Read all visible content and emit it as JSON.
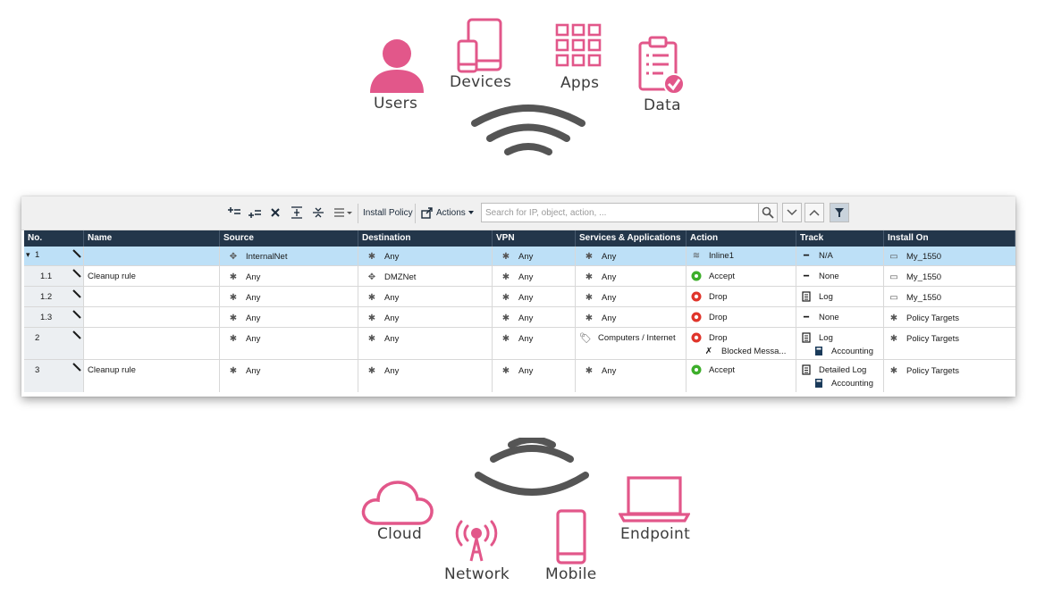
{
  "top_icons": [
    {
      "label": "Users",
      "icon": "user-icon"
    },
    {
      "label": "Devices",
      "icon": "devices-icon"
    },
    {
      "label": "Apps",
      "icon": "apps-grid-icon"
    },
    {
      "label": "Data",
      "icon": "clipboard-check-icon"
    }
  ],
  "bottom_icons": [
    {
      "label": "Cloud",
      "icon": "cloud-icon"
    },
    {
      "label": "Network",
      "icon": "network-antenna-icon"
    },
    {
      "label": "Mobile",
      "icon": "mobile-icon"
    },
    {
      "label": "Endpoint",
      "icon": "laptop-icon"
    }
  ],
  "colors": {
    "accent": "#e2578a",
    "wifi": "#555555",
    "header": "#23364a",
    "selected_row": "#bde0f7",
    "accept": "#3dae2b",
    "drop": "#e0352b"
  },
  "toolbar": {
    "install_policy": "Install Policy",
    "actions": "Actions",
    "search_placeholder": "Search for IP, object, action, ..."
  },
  "columns": [
    "No.",
    "Name",
    "Source",
    "Destination",
    "VPN",
    "Services & Applications",
    "Action",
    "Track",
    "Install On"
  ],
  "rows": [
    {
      "no": "1",
      "expander": "▾",
      "name": "",
      "source": "InternalNet",
      "destination": "Any",
      "vpn": "Any",
      "services": "Any",
      "action": "Inline1",
      "track": "N/A",
      "track2": "",
      "install_on": "My_1550"
    },
    {
      "no": "1.1",
      "name": "Cleanup rule",
      "source": "Any",
      "destination": "DMZNet",
      "vpn": "Any",
      "services": "Any",
      "action": "Accept",
      "track": "None",
      "track2": "",
      "install_on": "My_1550"
    },
    {
      "no": "1.2",
      "name": "",
      "source": "Any",
      "destination": "Any",
      "vpn": "Any",
      "services": "Any",
      "action": "Drop",
      "track": "Log",
      "track2": "",
      "install_on": "My_1550"
    },
    {
      "no": "1.3",
      "name": "",
      "source": "Any",
      "destination": "Any",
      "vpn": "Any",
      "services": "Any",
      "action": "Drop",
      "track": "None",
      "track2": "",
      "install_on": "Policy Targets"
    },
    {
      "no": "2",
      "name": "",
      "source": "Any",
      "destination": "Any",
      "vpn": "Any",
      "services": "Computers / Internet",
      "action": "Drop",
      "action2": "Blocked Messa...",
      "track": "Log",
      "track2": "Accounting",
      "install_on": "Policy Targets"
    },
    {
      "no": "3",
      "name": "Cleanup rule",
      "source": "Any",
      "destination": "Any",
      "vpn": "Any",
      "services": "Any",
      "action": "Accept",
      "track": "Detailed Log",
      "track2": "Accounting",
      "install_on": "Policy Targets"
    }
  ]
}
